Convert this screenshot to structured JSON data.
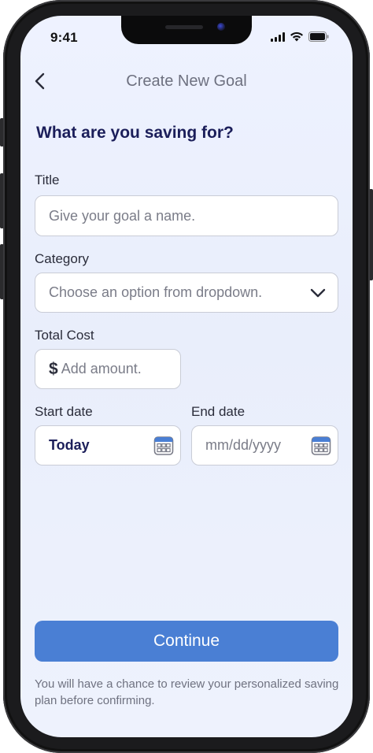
{
  "status_bar": {
    "time": "9:41",
    "signal_icon": "cellular-signal-icon",
    "wifi_icon": "wifi-icon",
    "battery_icon": "battery-icon"
  },
  "header": {
    "back_icon": "chevron-left-icon",
    "title": "Create New Goal"
  },
  "form": {
    "headline": "What are you saving for?",
    "title_field": {
      "label": "Title",
      "placeholder": "Give your goal a name."
    },
    "category_field": {
      "label": "Category",
      "placeholder": "Choose an option from dropdown.",
      "icon": "chevron-down-icon"
    },
    "total_cost_field": {
      "label": "Total Cost",
      "currency_symbol": "$",
      "placeholder": "Add amount."
    },
    "start_date_field": {
      "label": "Start date",
      "value": "Today",
      "icon": "calendar-icon"
    },
    "end_date_field": {
      "label": "End date",
      "placeholder": "mm/dd/yyyy",
      "icon": "calendar-icon"
    }
  },
  "actions": {
    "continue_label": "Continue"
  },
  "footnote": "You will have a chance to review your personalized saving plan before confirming.",
  "colors": {
    "accent": "#4a7fd4",
    "headline": "#1b1e5a",
    "background": "#eef2ff"
  }
}
